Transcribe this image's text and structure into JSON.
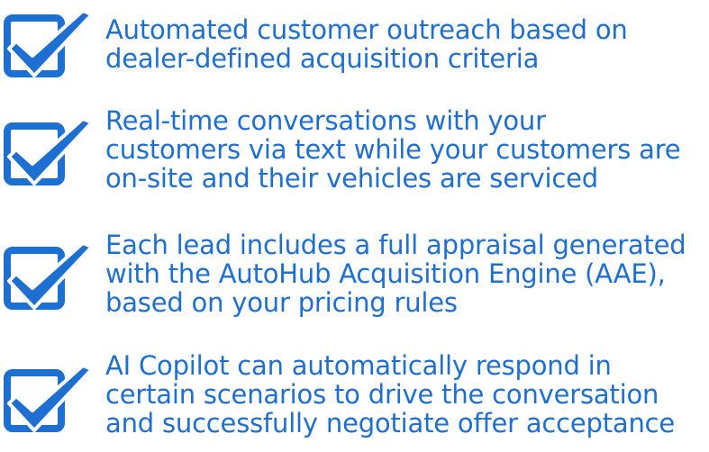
{
  "colors": {
    "accent": "#1d6fd1",
    "background": "#ffffff"
  },
  "features": [
    {
      "icon": "checkbox-checked-icon",
      "lines": [
        "Automated customer outreach based on",
        "dealer-defined acquisition criteria"
      ]
    },
    {
      "icon": "checkbox-checked-icon",
      "lines": [
        "Real-time conversations with your",
        "customers via text while your customers are",
        "on-site and their vehicles are serviced"
      ]
    },
    {
      "icon": "checkbox-checked-icon",
      "lines": [
        "Each lead includes a full appraisal generated",
        "with the AutoHub Acquisition Engine (AAE),",
        "based on your pricing rules"
      ]
    },
    {
      "icon": "checkbox-checked-icon",
      "lines": [
        "AI Copilot can automatically respond in",
        "certain scenarios to drive the conversation",
        "and successfully negotiate offer acceptance"
      ]
    }
  ]
}
